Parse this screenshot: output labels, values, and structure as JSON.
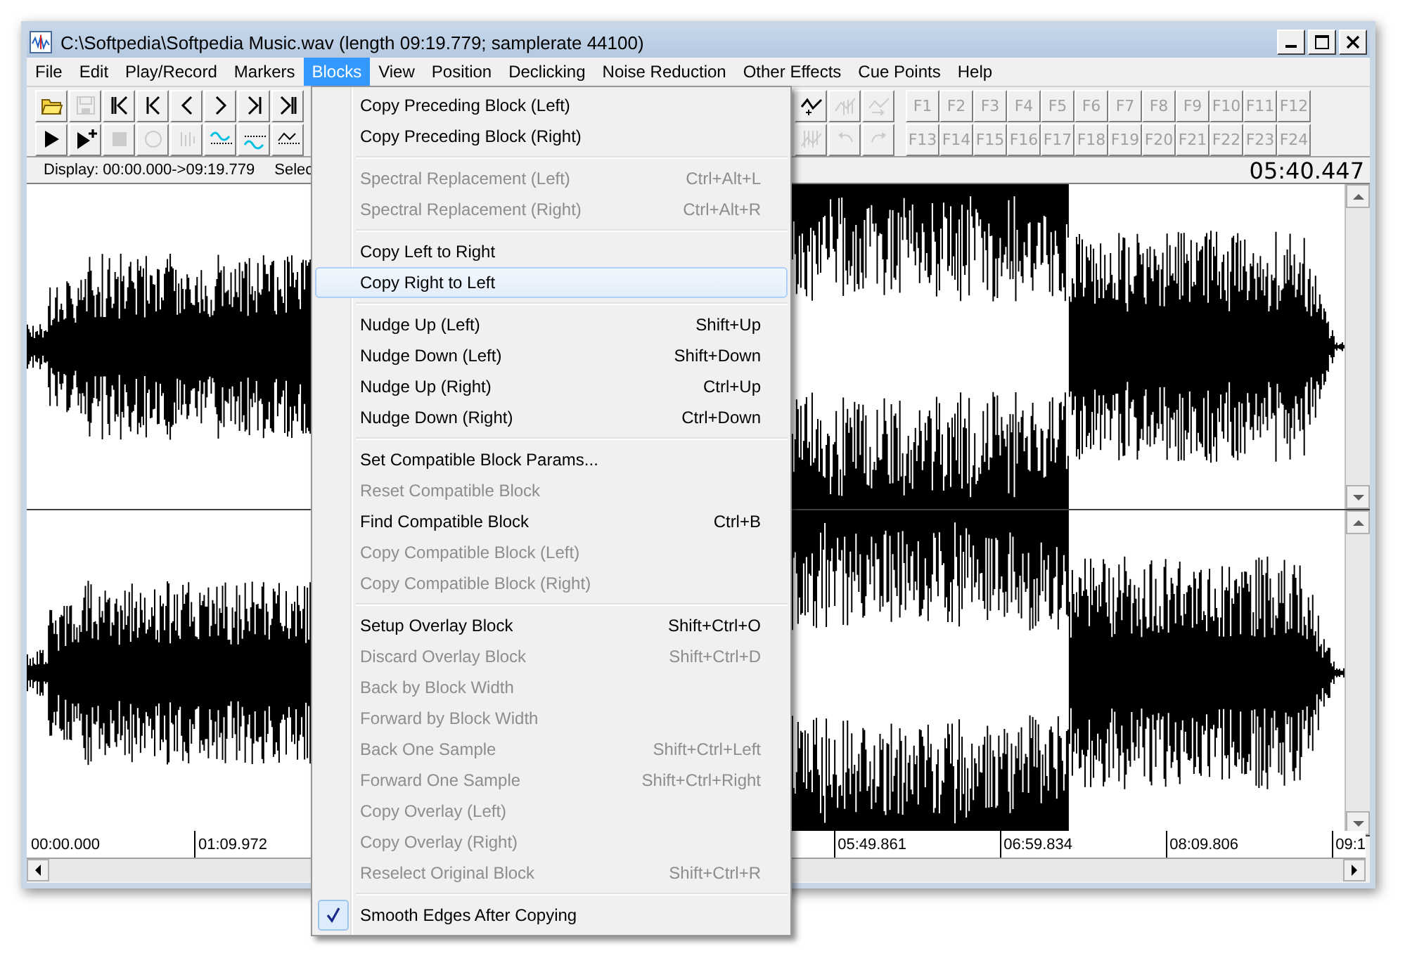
{
  "window": {
    "title": "C:\\Softpedia\\Softpedia Music.wav (length 09:19.779; samplerate 44100)"
  },
  "menu_bar": [
    {
      "label": "File",
      "selected": false
    },
    {
      "label": "Edit",
      "selected": false
    },
    {
      "label": "Play/Record",
      "selected": false
    },
    {
      "label": "Markers",
      "selected": false
    },
    {
      "label": "Blocks",
      "selected": true
    },
    {
      "label": "View",
      "selected": false
    },
    {
      "label": "Position",
      "selected": false
    },
    {
      "label": "Declicking",
      "selected": false
    },
    {
      "label": "Noise Reduction",
      "selected": false
    },
    {
      "label": "Other Effects",
      "selected": false
    },
    {
      "label": "Cue Points",
      "selected": false
    },
    {
      "label": "Help",
      "selected": false
    }
  ],
  "toolbar_left": {
    "rows": [
      [
        {
          "kind": "open",
          "disabled": false
        },
        {
          "kind": "save",
          "disabled": true
        },
        {
          "kind": "first",
          "disabled": false
        },
        {
          "kind": "prevmark",
          "disabled": false
        },
        {
          "kind": "prev",
          "disabled": false
        },
        {
          "kind": "next",
          "disabled": false
        },
        {
          "kind": "nextmark",
          "disabled": false
        },
        {
          "kind": "last",
          "disabled": false
        }
      ],
      [
        {
          "kind": "play",
          "disabled": false
        },
        {
          "kind": "playplus",
          "disabled": false
        },
        {
          "kind": "stop",
          "disabled": true
        },
        {
          "kind": "record",
          "disabled": true
        },
        {
          "kind": "bars",
          "disabled": true
        },
        {
          "kind": "wavetop",
          "disabled": false
        },
        {
          "kind": "wavebottom",
          "disabled": false
        },
        {
          "kind": "wavepeak",
          "disabled": false
        }
      ]
    ]
  },
  "toolbar_right": {
    "rows": [
      [
        {
          "kind": "waveplus",
          "disabled": false
        },
        {
          "kind": "wavebars",
          "disabled": true
        },
        {
          "kind": "wavearrow",
          "disabled": true
        },
        {
          "kind": "fkey",
          "label": "F1",
          "disabled": true
        },
        {
          "kind": "fkey",
          "label": "F2",
          "disabled": true
        },
        {
          "kind": "fkey",
          "label": "F3",
          "disabled": true
        },
        {
          "kind": "fkey",
          "label": "F4",
          "disabled": true
        },
        {
          "kind": "fkey",
          "label": "F5",
          "disabled": true
        },
        {
          "kind": "fkey",
          "label": "F6",
          "disabled": true
        },
        {
          "kind": "fkey",
          "label": "F7",
          "disabled": true
        },
        {
          "kind": "fkey",
          "label": "F8",
          "disabled": true
        },
        {
          "kind": "fkey",
          "label": "F9",
          "disabled": true
        },
        {
          "kind": "fkey",
          "label": "F10",
          "disabled": true
        },
        {
          "kind": "fkey",
          "label": "F11",
          "disabled": true
        },
        {
          "kind": "fkey",
          "label": "F12",
          "disabled": true
        }
      ],
      [
        {
          "kind": "wavestriped",
          "disabled": true
        },
        {
          "kind": "undo",
          "disabled": true
        },
        {
          "kind": "redo",
          "disabled": true
        },
        {
          "kind": "fkey",
          "label": "F13",
          "disabled": true
        },
        {
          "kind": "fkey",
          "label": "F14",
          "disabled": true
        },
        {
          "kind": "fkey",
          "label": "F15",
          "disabled": true
        },
        {
          "kind": "fkey",
          "label": "F16",
          "disabled": true
        },
        {
          "kind": "fkey",
          "label": "F17",
          "disabled": true
        },
        {
          "kind": "fkey",
          "label": "F18",
          "disabled": true
        },
        {
          "kind": "fkey",
          "label": "F19",
          "disabled": true
        },
        {
          "kind": "fkey",
          "label": "F20",
          "disabled": true
        },
        {
          "kind": "fkey",
          "label": "F21",
          "disabled": true
        },
        {
          "kind": "fkey",
          "label": "F22",
          "disabled": true
        },
        {
          "kind": "fkey",
          "label": "F23",
          "disabled": true
        },
        {
          "kind": "fkey",
          "label": "F24",
          "disabled": true
        }
      ]
    ]
  },
  "status": {
    "display": "Display: 00:00.000->09:19.779",
    "selection": "Selec",
    "time": "05:40.447"
  },
  "ruler": {
    "left_labels": [
      "00:00.000",
      "01:09.972"
    ],
    "right_labels": [
      "05:49.861",
      "06:59.834",
      "08:09.806",
      "09:1"
    ]
  },
  "menu": {
    "items": [
      {
        "kind": "item",
        "label": "Copy Preceding Block (Left)",
        "disabled": false,
        "selected": false,
        "checked": false
      },
      {
        "kind": "item",
        "label": "Copy Preceding Block (Right)",
        "disabled": false,
        "selected": false,
        "checked": false
      },
      {
        "kind": "separator"
      },
      {
        "kind": "item",
        "label": "Spectral Replacement (Left)",
        "shortcut": "Ctrl+Alt+L",
        "disabled": true,
        "selected": false,
        "checked": false
      },
      {
        "kind": "item",
        "label": "Spectral Replacement (Right)",
        "shortcut": "Ctrl+Alt+R",
        "disabled": true,
        "selected": false,
        "checked": false
      },
      {
        "kind": "separator"
      },
      {
        "kind": "item",
        "label": "Copy Left to Right",
        "disabled": false,
        "selected": false,
        "checked": false
      },
      {
        "kind": "item",
        "label": "Copy Right to Left",
        "disabled": false,
        "selected": true,
        "checked": false
      },
      {
        "kind": "separator"
      },
      {
        "kind": "item",
        "label": "Nudge Up (Left)",
        "shortcut": "Shift+Up",
        "disabled": false,
        "selected": false,
        "checked": false
      },
      {
        "kind": "item",
        "label": "Nudge Down (Left)",
        "shortcut": "Shift+Down",
        "disabled": false,
        "selected": false,
        "checked": false
      },
      {
        "kind": "item",
        "label": "Nudge Up (Right)",
        "shortcut": "Ctrl+Up",
        "disabled": false,
        "selected": false,
        "checked": false
      },
      {
        "kind": "item",
        "label": "Nudge Down (Right)",
        "shortcut": "Ctrl+Down",
        "disabled": false,
        "selected": false,
        "checked": false
      },
      {
        "kind": "separator"
      },
      {
        "kind": "item",
        "label": "Set Compatible Block Params...",
        "disabled": false,
        "selected": false,
        "checked": false
      },
      {
        "kind": "item",
        "label": "Reset Compatible Block",
        "disabled": true,
        "selected": false,
        "checked": false
      },
      {
        "kind": "item",
        "label": "Find Compatible Block",
        "shortcut": "Ctrl+B",
        "disabled": false,
        "selected": false,
        "checked": false
      },
      {
        "kind": "item",
        "label": "Copy Compatible Block (Left)",
        "disabled": true,
        "selected": false,
        "checked": false
      },
      {
        "kind": "item",
        "label": "Copy Compatible Block (Right)",
        "disabled": true,
        "selected": false,
        "checked": false
      },
      {
        "kind": "separator"
      },
      {
        "kind": "item",
        "label": "Setup Overlay Block",
        "shortcut": "Shift+Ctrl+O",
        "disabled": false,
        "selected": false,
        "checked": false
      },
      {
        "kind": "item",
        "label": "Discard Overlay Block",
        "shortcut": "Shift+Ctrl+D",
        "disabled": true,
        "selected": false,
        "checked": false
      },
      {
        "kind": "item",
        "label": "Back by Block Width",
        "disabled": true,
        "selected": false,
        "checked": false
      },
      {
        "kind": "item",
        "label": "Forward by Block Width",
        "disabled": true,
        "selected": false,
        "checked": false
      },
      {
        "kind": "item",
        "label": "Back One Sample",
        "shortcut": "Shift+Ctrl+Left",
        "disabled": true,
        "selected": false,
        "checked": false
      },
      {
        "kind": "item",
        "label": "Forward One Sample",
        "shortcut": "Shift+Ctrl+Right",
        "disabled": true,
        "selected": false,
        "checked": false
      },
      {
        "kind": "item",
        "label": "Copy Overlay (Left)",
        "disabled": true,
        "selected": false,
        "checked": false
      },
      {
        "kind": "item",
        "label": "Copy Overlay (Right)",
        "disabled": true,
        "selected": false,
        "checked": false
      },
      {
        "kind": "item",
        "label": "Reselect Original Block",
        "shortcut": "Shift+Ctrl+R",
        "disabled": true,
        "selected": false,
        "checked": false
      },
      {
        "kind": "separator"
      },
      {
        "kind": "item",
        "label": "Smooth Edges After Copying",
        "disabled": false,
        "selected": false,
        "checked": true
      }
    ]
  }
}
